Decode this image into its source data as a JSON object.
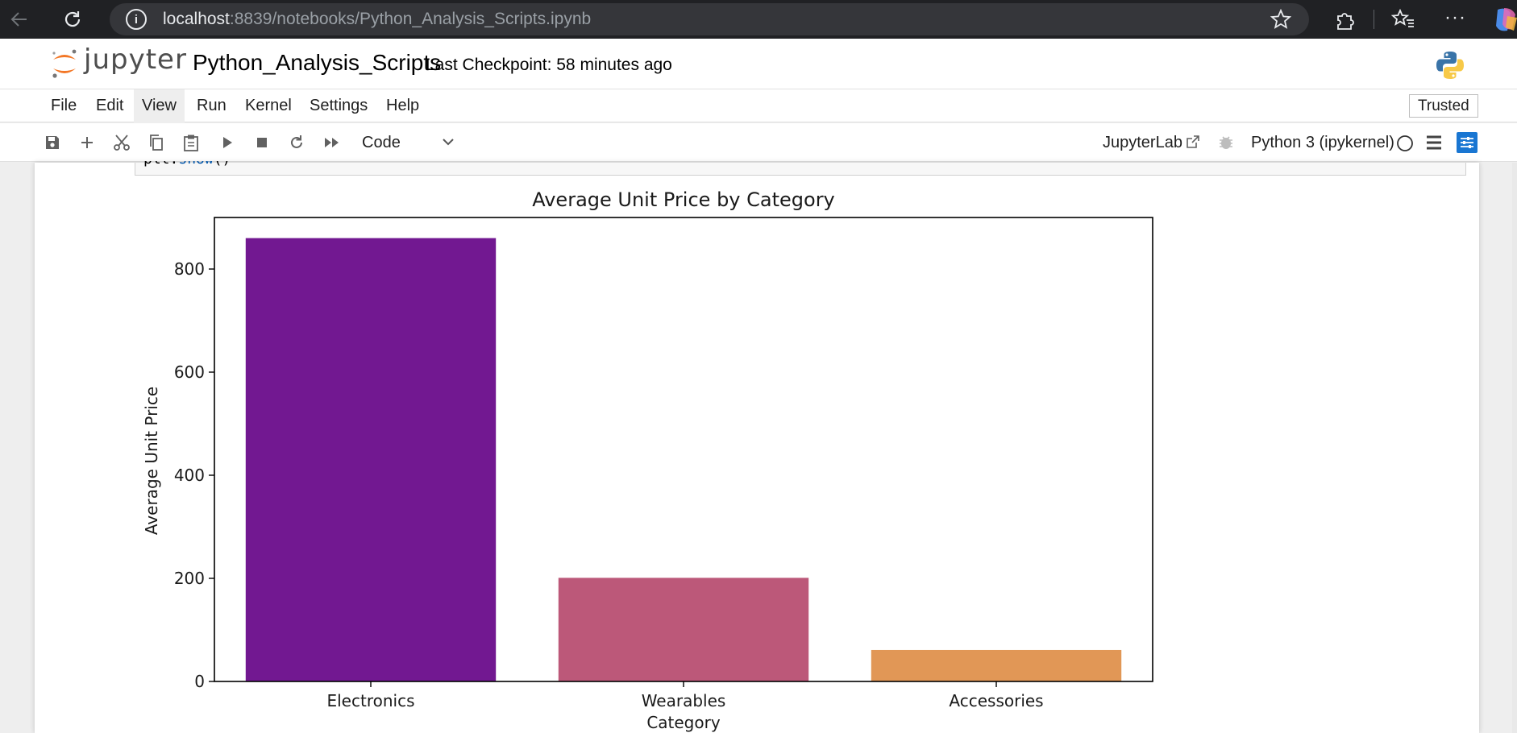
{
  "browser": {
    "url_host": "localhost",
    "url_rest": ":8839/notebooks/Python_Analysis_Scripts.ipynb"
  },
  "header": {
    "logo_text": "jupyter",
    "notebook_title": "Python_Analysis_Scripts",
    "checkpoint": "Last Checkpoint: 58 minutes ago"
  },
  "menu": {
    "items": [
      "File",
      "Edit",
      "View",
      "Run",
      "Kernel",
      "Settings",
      "Help"
    ],
    "active": "View",
    "trusted_label": "Trusted"
  },
  "toolbar": {
    "cell_type": "Code",
    "jupyterlab_label": "JupyterLab",
    "kernel_name": "Python 3 (ipykernel)"
  },
  "code_fragment": {
    "obj": "plt.",
    "fn": "show",
    "args": "()"
  },
  "chart_data": {
    "type": "bar",
    "title": "Average Unit Price by Category",
    "xlabel": "Category",
    "ylabel": "Average Unit Price",
    "categories": [
      "Electronics",
      "Wearables",
      "Accessories"
    ],
    "values": [
      860,
      201,
      61
    ],
    "colors": [
      "#721891",
      "#bc5879",
      "#e19756"
    ],
    "ylim": [
      0,
      900
    ],
    "yticks": [
      0,
      200,
      400,
      600,
      800
    ],
    "grid": false
  }
}
